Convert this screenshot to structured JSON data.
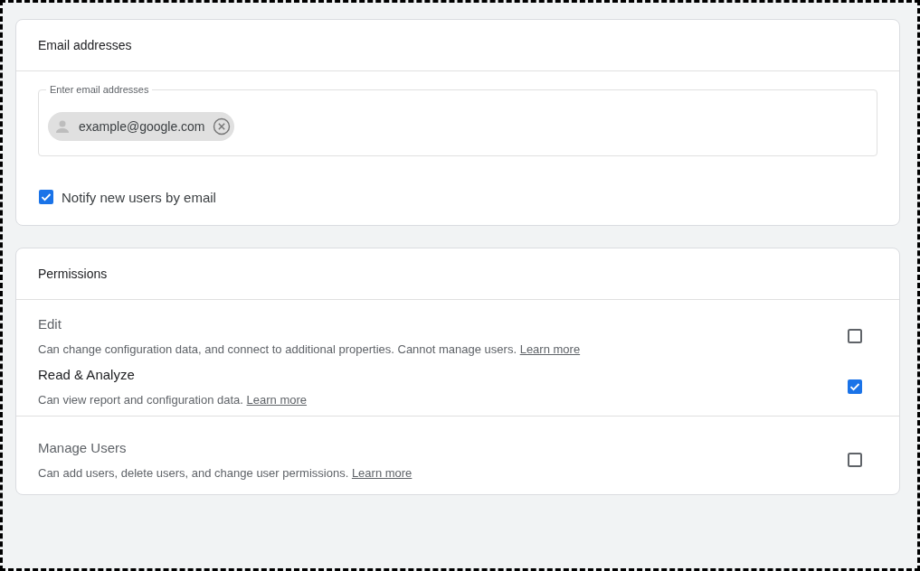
{
  "email_card": {
    "title": "Email addresses",
    "field": {
      "label": "Enter email addresses",
      "chips": [
        {
          "text": "example@google.com"
        }
      ]
    },
    "notify": {
      "label": "Notify new users by email",
      "checked": true
    }
  },
  "permissions_card": {
    "title": "Permissions",
    "groups": [
      [
        {
          "title": "Edit",
          "description": "Can change configuration data, and connect to additional properties. Cannot manage users.",
          "link": "Learn more",
          "checked": false
        },
        {
          "title": "Read & Analyze",
          "description": "Can view report and configuration data.",
          "link": "Learn more",
          "checked": true
        }
      ],
      [
        {
          "title": "Manage Users",
          "description": "Can add users, delete users, and change user permissions.",
          "link": "Learn more",
          "checked": false
        }
      ]
    ]
  }
}
